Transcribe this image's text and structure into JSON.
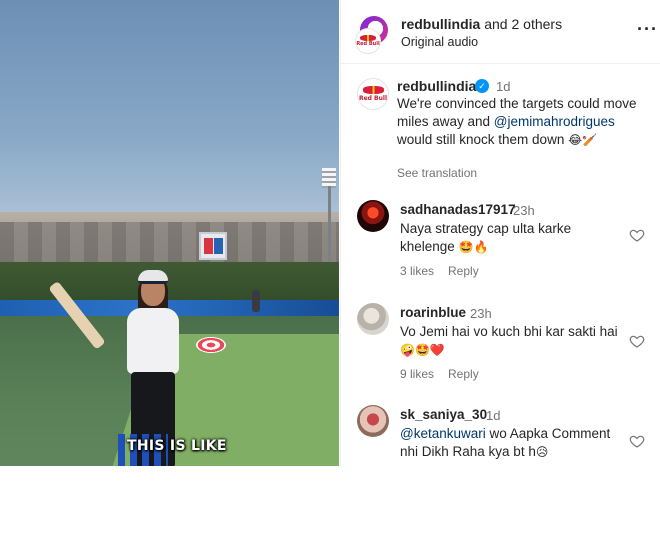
{
  "media": {
    "caption_overlay": "THIS IS LIKE"
  },
  "header": {
    "account": "redbullindia",
    "collab_suffix": " and 2 others",
    "audio": "Original audio",
    "more_icon": "more-horizontal-icon"
  },
  "post": {
    "username": "redbullindia",
    "time": "1d",
    "text_before": "We're convinced the targets could move miles away and ",
    "mention": "@jemimahrodrigues",
    "text_after": " would still knock them down ",
    "emoji": "😂🏏",
    "see_translation": "See translation"
  },
  "comments": [
    {
      "username": "sadhanadas17917",
      "time": "23h",
      "text": "Naya strategy cap ulta karke khelenge ",
      "emoji": "🤩🔥",
      "likes": "3 likes",
      "reply": "Reply"
    },
    {
      "username": "roarinblue",
      "time": "23h",
      "text": "Vo Jemi hai vo kuch bhi kar sakti hai ",
      "emoji": "🤪🤩❤️",
      "likes": "9 likes",
      "reply": "Reply"
    },
    {
      "username": "sk_saniya_30",
      "time": "1d",
      "mention": "@ketankuwari",
      "text": " wo Aapka Comment nhi Dikh Raha kya bt h",
      "emoji": "😥"
    }
  ],
  "colors": {
    "link": "#00376b",
    "verified": "#0095f6",
    "muted": "#737373",
    "text": "#262626"
  }
}
